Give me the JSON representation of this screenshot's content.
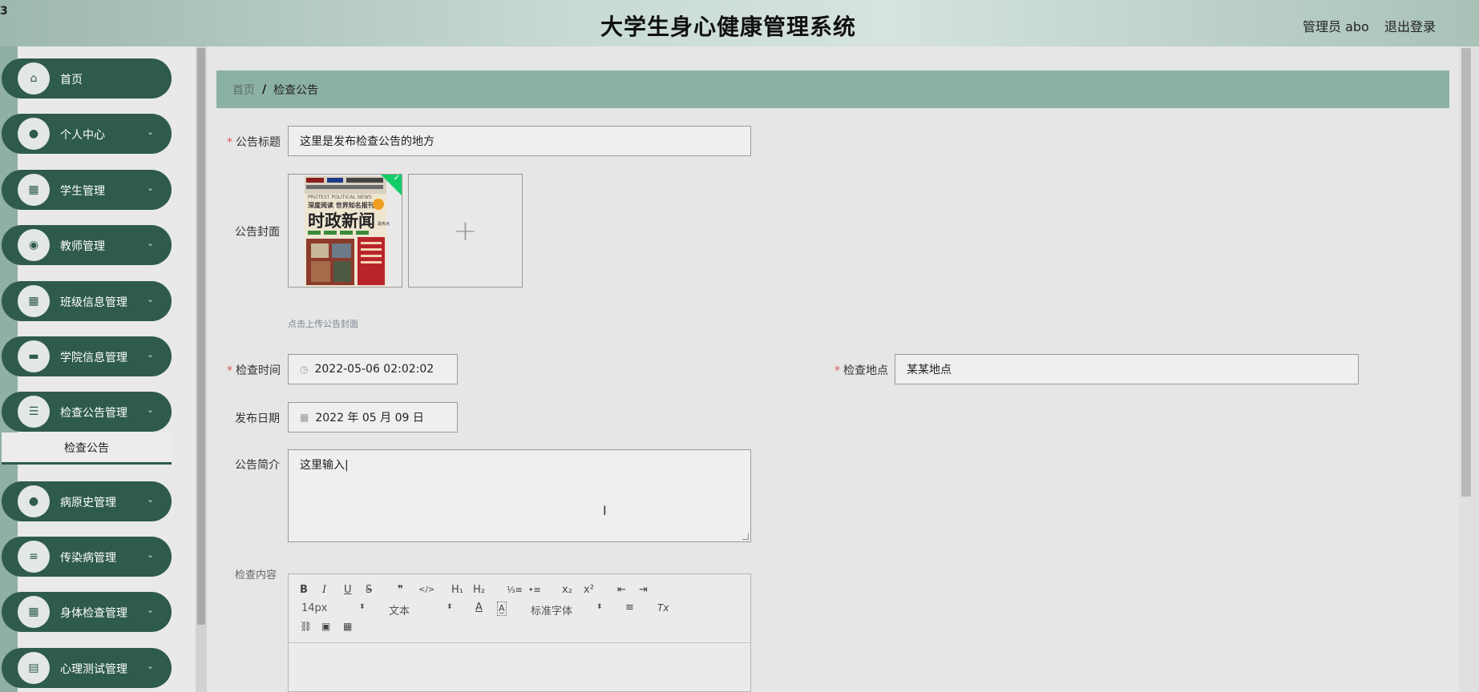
{
  "header": {
    "corner_glyph": "3",
    "title": "大学生身心健康管理系统",
    "user": "管理员 abo",
    "logout": "退出登录"
  },
  "sidebar": {
    "items": [
      {
        "label": "首页",
        "icon": "home-icon",
        "glyph": "⌂",
        "expandable": false
      },
      {
        "label": "个人中心",
        "icon": "user-icon",
        "glyph": "●",
        "expandable": true
      },
      {
        "label": "学生管理",
        "icon": "grid-icon",
        "glyph": "▦",
        "expandable": true
      },
      {
        "label": "教师管理",
        "icon": "pin-icon",
        "glyph": "◉",
        "expandable": true
      },
      {
        "label": "班级信息管理",
        "icon": "grid-icon",
        "glyph": "▦",
        "expandable": true
      },
      {
        "label": "学院信息管理",
        "icon": "briefcase-icon",
        "glyph": "▬",
        "expandable": true
      },
      {
        "label": "检查公告管理",
        "icon": "sliders-icon",
        "glyph": "☰",
        "expandable": true
      },
      {
        "label": "病原史管理",
        "icon": "user-icon",
        "glyph": "●",
        "expandable": true
      },
      {
        "label": "传染病管理",
        "icon": "list-icon",
        "glyph": "≡",
        "expandable": true
      },
      {
        "label": "身体检查管理",
        "icon": "grid-icon",
        "glyph": "▦",
        "expandable": true
      },
      {
        "label": "心理测试管理",
        "icon": "chart-icon",
        "glyph": "▤",
        "expandable": true
      }
    ],
    "submenu_active": "检查公告"
  },
  "breadcrumb": {
    "home": "首页",
    "separator": "/",
    "current": "检查公告"
  },
  "form": {
    "title_label": "公告标题",
    "title_value": "这里是发布检查公告的地方",
    "cover_label": "公告封面",
    "cover_hint": "点击上传公告封面",
    "cover_image": {
      "top_text": "PROTEST POLITICAL NEWS",
      "subtitle": "深度阅读 世界知名报刊",
      "main_text": "时政新闻",
      "side_text": "最热点"
    },
    "check_time_label": "检查时间",
    "check_time_value": "2022-05-06 02:02:02",
    "check_place_label": "检查地点",
    "check_place_value": "某某地点",
    "publish_date_label": "发布日期",
    "publish_date_value": "2022 年 05 月 09 日",
    "intro_label": "公告简介",
    "intro_value": "这里输入|",
    "content_label": "检查内容"
  },
  "editor": {
    "font_size": "14px",
    "text_style": "文本",
    "font_family": "标准字体",
    "buttons": {
      "bold": "B",
      "italic": "I",
      "underline": "U",
      "strike": "S",
      "quote": "❞",
      "code": "</>",
      "h1": "H₁",
      "h2": "H₂",
      "ordered_list": "⅓≡",
      "bullet_list": "•≡",
      "subscript": "x₂",
      "superscript": "x²",
      "outdent": "⇤",
      "indent": "⇥",
      "font_color": "A",
      "bg_color": "A̲",
      "align": "≡",
      "clean": "Tx",
      "link": "🔗",
      "image": "▣",
      "video": "▦"
    }
  },
  "colors": {
    "accent": "#2e5b4c",
    "breadcrumb_bg": "#8bb1a3",
    "required": "#e05555",
    "upload_success": "#13ce66"
  }
}
